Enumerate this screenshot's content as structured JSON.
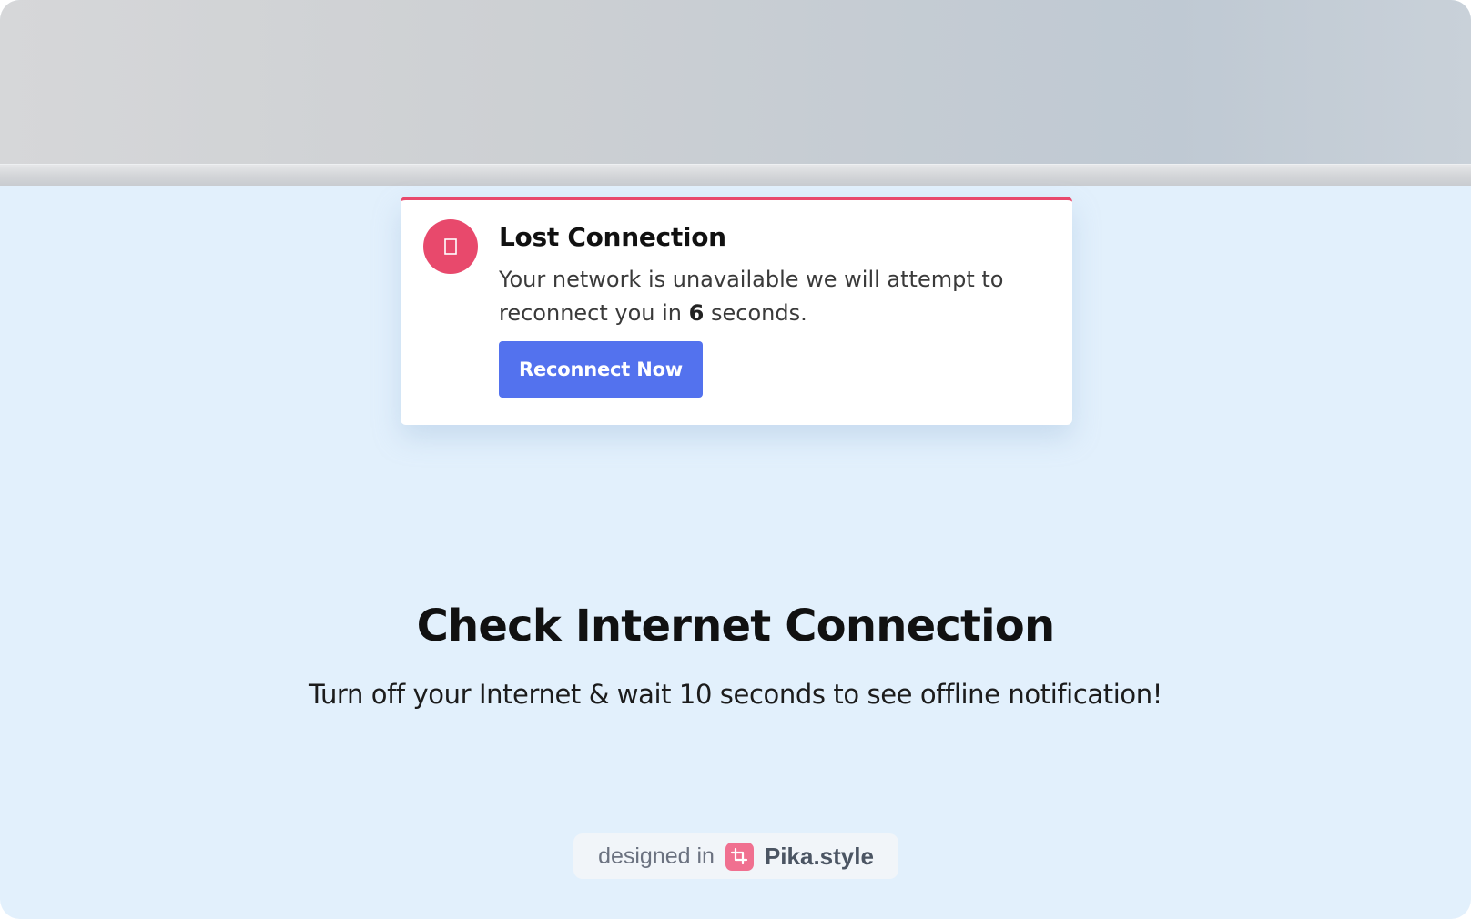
{
  "toast": {
    "title": "Lost Connection",
    "message_prefix": "Your network is unavailable we will attempt to reconnect you in",
    "countdown": "6",
    "message_suffix": "seconds.",
    "button_label": "Reconnect Now",
    "icon": "wifi-off-icon",
    "accent_color": "#e8496c",
    "button_color": "#5372ee"
  },
  "main": {
    "headline": "Check Internet Connection",
    "subline": "Turn off your Internet & wait 10 seconds to see offline notification!"
  },
  "badge": {
    "prefix": "designed in",
    "brand": "Pika.style",
    "icon": "crop-icon"
  },
  "colors": {
    "page_background": "#e2f0fc"
  }
}
